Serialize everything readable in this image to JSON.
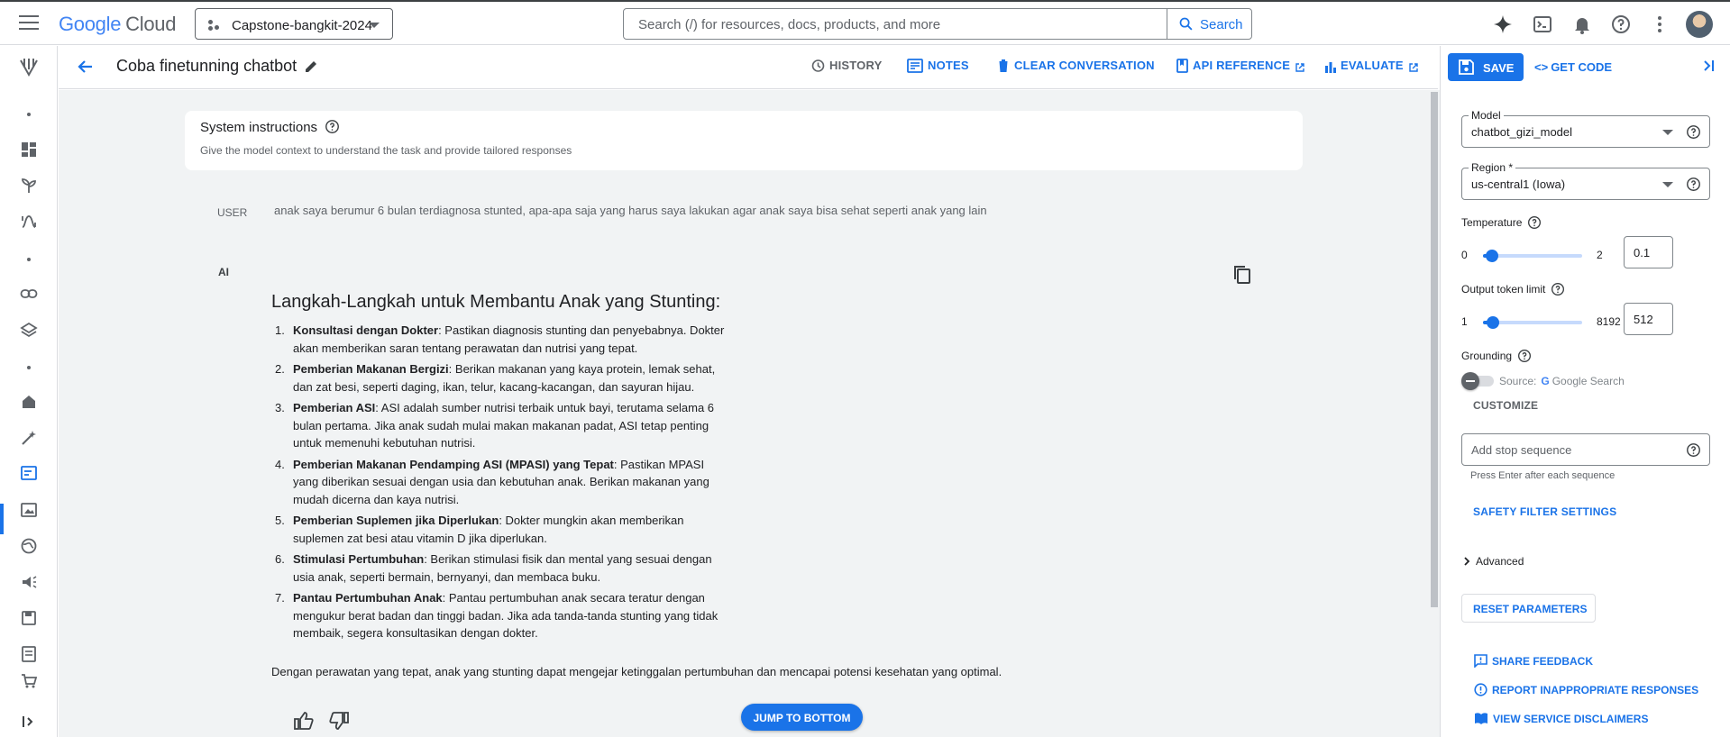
{
  "topbar": {
    "brand_google": "Google",
    "brand_cloud": "Cloud",
    "project": "Capstone-bangkit-2024",
    "search_placeholder": "Search (/) for resources, docs, products, and more",
    "search_button": "Search"
  },
  "subbar": {
    "title": "Coba finetunning chatbot",
    "actions": [
      "HISTORY",
      "NOTES",
      "CLEAR CONVERSATION",
      "API REFERENCE",
      "EVALUATE"
    ]
  },
  "system": {
    "title": "System instructions",
    "subtitle": "Give the model context to understand the task and provide tailored responses"
  },
  "conversation": {
    "user_role": "USER",
    "user_message": "anak saya berumur 6 bulan terdiagnosa stunted, apa-apa saja yang harus saya lakukan agar anak saya bisa sehat seperti anak yang lain",
    "ai_role": "AI",
    "ai_title": "Langkah-Langkah untuk Membantu Anak yang Stunting:",
    "steps": [
      {
        "num": "1.",
        "bold": "Konsultasi dengan Dokter",
        "text": ": Pastikan diagnosis stunting dan penyebabnya. Dokter akan memberikan saran tentang perawatan dan nutrisi yang tepat."
      },
      {
        "num": "2.",
        "bold": "Pemberian Makanan Bergizi",
        "text": ": Berikan makanan yang kaya protein, lemak sehat, dan zat besi, seperti daging, ikan, telur, kacang-kacangan, dan sayuran hijau."
      },
      {
        "num": "3.",
        "bold": "Pemberian ASI",
        "text": ": ASI adalah sumber nutrisi terbaik untuk bayi, terutama selama 6 bulan pertama. Jika anak sudah mulai makan makanan padat, ASI tetap penting untuk memenuhi kebutuhan nutrisi."
      },
      {
        "num": "4.",
        "bold": "Pemberian Makanan Pendamping ASI (MPASI) yang Tepat",
        "text": ": Pastikan MPASI yang diberikan sesuai dengan usia dan kebutuhan anak. Berikan makanan yang mudah dicerna dan kaya nutrisi."
      },
      {
        "num": "5.",
        "bold": "Pemberian Suplemen jika Diperlukan",
        "text": ": Dokter mungkin akan memberikan suplemen zat besi atau vitamin D jika diperlukan."
      },
      {
        "num": "6.",
        "bold": "Stimulasi Pertumbuhan",
        "text": ": Berikan stimulasi fisik dan mental yang sesuai dengan usia anak, seperti bermain, bernyanyi, dan membaca buku."
      },
      {
        "num": "7.",
        "bold": "Pantau Pertumbuhan Anak",
        "text": ": Pantau pertumbuhan anak secara teratur dengan mengukur berat badan dan tinggi badan. Jika ada tanda-tanda stunting yang tidak membaik, segera konsultasikan dengan dokter."
      }
    ],
    "closing": "Dengan perawatan yang tepat, anak yang stunting dapat mengejar ketinggalan pertumbuhan dan mencapai potensi kesehatan yang optimal.",
    "jump_button": "JUMP TO BOTTOM"
  },
  "panel": {
    "save": "SAVE",
    "get_code": "GET CODE",
    "model_label": "Model",
    "model_value": "chatbot_gizi_model",
    "region_label": "Region *",
    "region_value": "us-central1 (Iowa)",
    "temperature_label": "Temperature",
    "temperature": {
      "min": "0",
      "max": "2",
      "value": "0.1",
      "fraction": 0.05
    },
    "token_label": "Output token limit",
    "tokens": {
      "min": "1",
      "max": "8192",
      "value": "512",
      "fraction": 0.0624
    },
    "grounding_label": "Grounding",
    "source_prefix": "Source:",
    "source_g": "G",
    "source_name": "Google Search",
    "customize": "CUSTOMIZE",
    "stop_placeholder": "Add stop sequence",
    "stop_hint": "Press Enter after each sequence",
    "safety": "SAFETY FILTER SETTINGS",
    "advanced": "Advanced",
    "reset": "RESET PARAMETERS",
    "share_feedback": "SHARE FEEDBACK",
    "report": "REPORT INAPPROPRIATE RESPONSES",
    "disclaimers": "VIEW SERVICE DISCLAIMERS"
  },
  "colors": {
    "accent": "#1a73e8",
    "surface": "#f1f3f4"
  }
}
